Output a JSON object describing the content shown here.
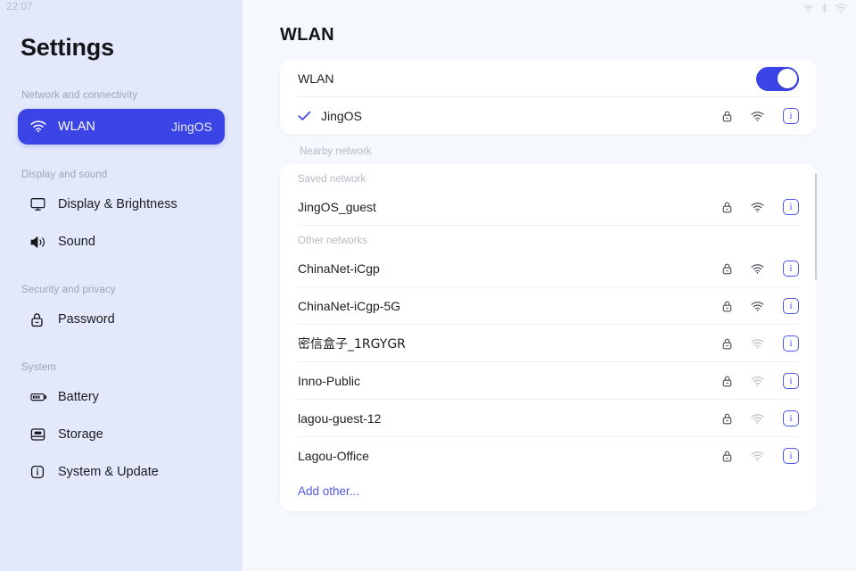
{
  "statusbar": {
    "time": "22:07",
    "icons": [
      "cast-icon",
      "bluetooth-icon",
      "wifi-icon"
    ]
  },
  "sidebar": {
    "app_title": "Settings",
    "groups": [
      {
        "label": "Network and connectivity",
        "items": [
          {
            "label": "WLAN",
            "icon": "wifi-icon",
            "value": "JingOS",
            "active": true
          }
        ]
      },
      {
        "label": "Display and sound",
        "items": [
          {
            "label": "Display & Brightness",
            "icon": "monitor-icon",
            "value": "",
            "active": false
          },
          {
            "label": "Sound",
            "icon": "speaker-icon",
            "value": "",
            "active": false
          }
        ]
      },
      {
        "label": "Security and privacy",
        "items": [
          {
            "label": "Password",
            "icon": "lock-icon",
            "value": "",
            "active": false
          }
        ]
      },
      {
        "label": "System",
        "items": [
          {
            "label": "Battery",
            "icon": "battery-icon",
            "value": "",
            "active": false
          },
          {
            "label": "Storage",
            "icon": "storage-icon",
            "value": "",
            "active": false
          },
          {
            "label": "System & Update",
            "icon": "info-circle-icon",
            "value": "",
            "active": false
          }
        ]
      }
    ]
  },
  "main": {
    "page_title": "WLAN",
    "wlan_card": {
      "toggle_label": "WLAN",
      "toggle_on": true,
      "connected": {
        "name": "JingOS",
        "connected": true,
        "secured": true,
        "signal": "strong"
      }
    },
    "nearby_label": "Nearby network",
    "saved_label": "Saved network",
    "saved_networks": [
      {
        "name": "JingOS_guest",
        "secured": true,
        "signal": "strong"
      }
    ],
    "other_label": "Other networks",
    "other_networks": [
      {
        "name": "ChinaNet-iCgp",
        "secured": true,
        "signal": "strong"
      },
      {
        "name": "ChinaNet-iCgp-5G",
        "secured": true,
        "signal": "strong"
      },
      {
        "name": "密信盒子_1RGYGR",
        "secured": true,
        "signal": "weak"
      },
      {
        "name": "Inno-Public",
        "secured": true,
        "signal": "weak"
      },
      {
        "name": "lagou-guest-12",
        "secured": true,
        "signal": "weak"
      },
      {
        "name": "Lagou-Office",
        "secured": true,
        "signal": "weak"
      }
    ],
    "add_other_label": "Add other..."
  },
  "colors": {
    "accent": "#3b44e4",
    "link": "#4f57ea",
    "sidebar_bg": "#e3e9fb",
    "main_bg": "#f5f8fd",
    "card_bg": "#ffffff"
  }
}
